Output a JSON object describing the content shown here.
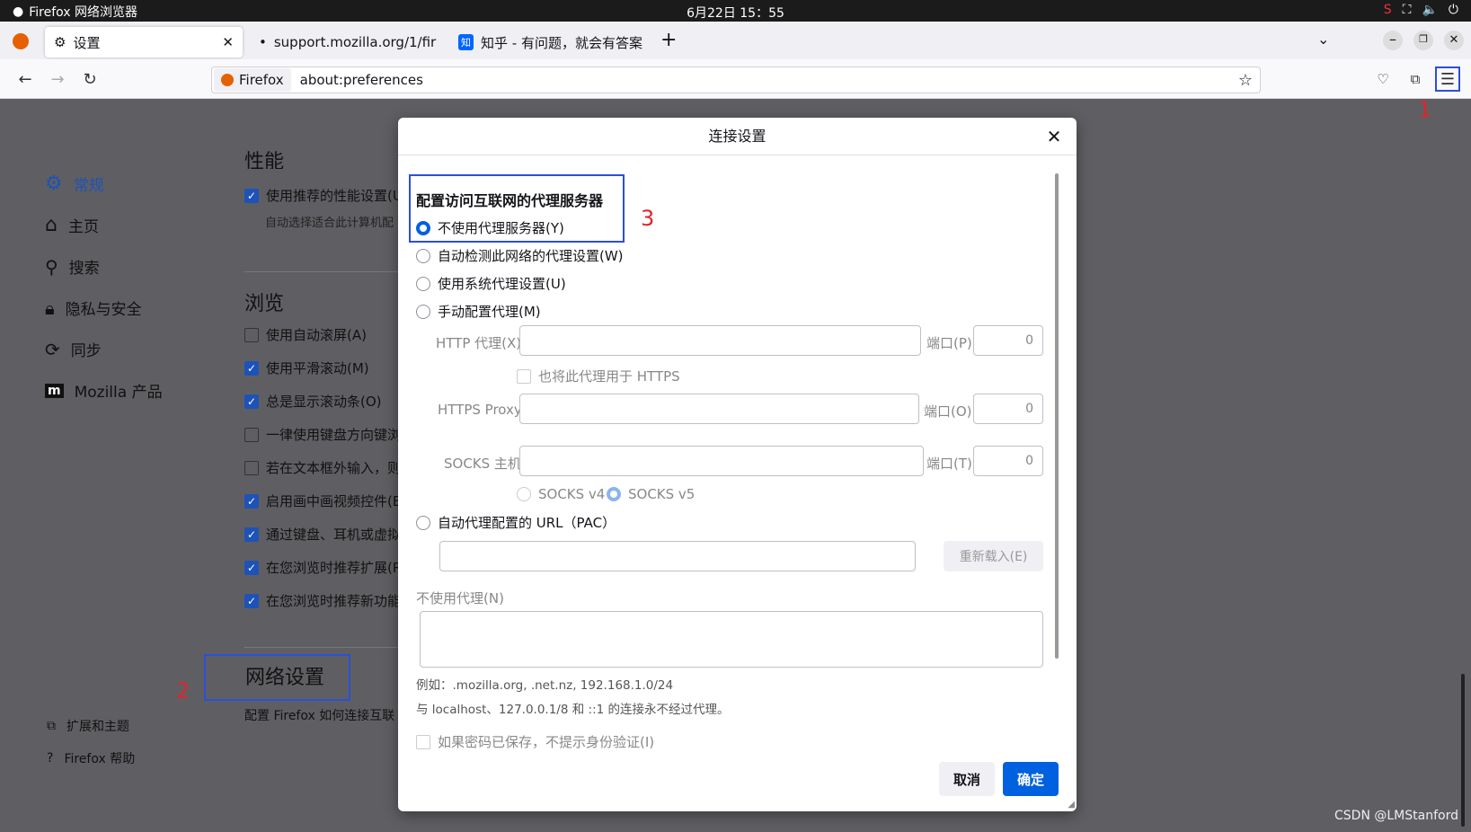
{
  "system": {
    "app_title": "Firefox 网络浏览器",
    "clock": "6月22日  15：55"
  },
  "tabs": [
    {
      "label": "设置",
      "active": true
    },
    {
      "label": "support.mozilla.org/1/fir",
      "active": false
    },
    {
      "label": "知乎 - 有问题，就会有答案",
      "active": false
    }
  ],
  "urlbar": {
    "identity": "Firefox",
    "url": "about:preferences"
  },
  "sidebar": {
    "items": [
      {
        "label": "常规",
        "active": true
      },
      {
        "label": "主页"
      },
      {
        "label": "搜索"
      },
      {
        "label": "隐私与安全"
      },
      {
        "label": "同步"
      },
      {
        "label": "Mozilla 产品"
      }
    ],
    "footer": [
      {
        "label": "扩展和主题"
      },
      {
        "label": "Firefox 帮助"
      }
    ]
  },
  "page": {
    "perf_heading": "性能",
    "perf_check": "使用推荐的性能设置(U",
    "perf_desc": "自动选择适合此计算机配",
    "browse_heading": "浏览",
    "browse_checks": [
      {
        "label": "使用自动滚屏(A)",
        "checked": false
      },
      {
        "label": "使用平滑滚动(M)",
        "checked": true
      },
      {
        "label": "总是显示滚动条(O)",
        "checked": true
      },
      {
        "label": "一律使用键盘方向键浏",
        "checked": false
      },
      {
        "label": "若在文本框外输入，则",
        "checked": false
      },
      {
        "label": "启用画中画视频控件(E",
        "checked": true
      },
      {
        "label": "通过键盘、耳机或虚拟",
        "checked": true
      },
      {
        "label": "在您浏览时推荐扩展(R",
        "checked": true
      },
      {
        "label": "在您浏览时推荐新功能",
        "checked": true
      }
    ],
    "network_heading": "网络设置",
    "network_desc": "配置 Firefox 如何连接互联"
  },
  "dialog": {
    "title": "连接设置",
    "section": "配置访问互联网的代理服务器",
    "options": [
      {
        "label": "不使用代理服务器(Y)",
        "selected": true
      },
      {
        "label": "自动检测此网络的代理设置(W)",
        "selected": false
      },
      {
        "label": "使用系统代理设置(U)",
        "selected": false
      },
      {
        "label": "手动配置代理(M)",
        "selected": false
      }
    ],
    "http_label": "HTTP 代理(X)",
    "port_p": "端口(P)",
    "port_value": "0",
    "https_also": "也将此代理用于 HTTPS",
    "https_label": "HTTPS Proxy",
    "port_o": "端口(O)",
    "socks_label": "SOCKS 主机",
    "port_t": "端口(T)",
    "socks_v4": "SOCKS v4",
    "socks_v5": "SOCKS v5",
    "pac_label": "自动代理配置的 URL（PAC）",
    "reload": "重新载入(E)",
    "no_proxy_label": "不使用代理(N)",
    "example": "例如：.mozilla.org, .net.nz, 192.168.1.0/24",
    "localhost_note": "与 localhost、127.0.0.1/8 和 ::1 的连接永不经过代理。",
    "no_auth_prompt": "如果密码已保存，不提示身份验证(I)",
    "cancel": "取消",
    "ok": "确定"
  },
  "annotations": {
    "a1": "1",
    "a2": "2",
    "a3": "3"
  },
  "watermark": "CSDN @LMStanford",
  "colors": {
    "accent": "#0061e0",
    "highlight": "#2b4fd8",
    "annotation": "#e0242b"
  }
}
